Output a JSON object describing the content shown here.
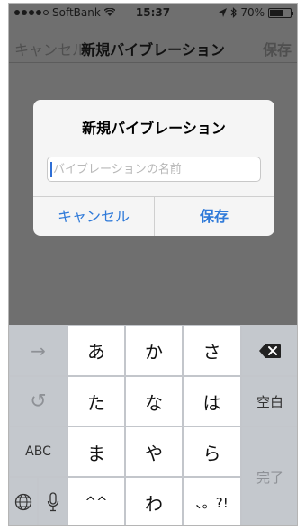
{
  "status": {
    "carrier": "SoftBank",
    "time": "15:37",
    "battery": "70%",
    "battery_level": 0.7
  },
  "navbar": {
    "cancel_label": "キャンセル",
    "title": "新規バイブレーション",
    "save_label": "保存"
  },
  "alert": {
    "title": "新規バイブレーション",
    "input_placeholder": "バイブレーションの名前",
    "input_value": "",
    "cancel_label": "キャンセル",
    "save_label": "保存"
  },
  "keyboard": {
    "left_column": [
      "→",
      "↺",
      "ABC"
    ],
    "rows": [
      [
        "あ",
        "か",
        "さ"
      ],
      [
        "た",
        "な",
        "は"
      ],
      [
        "ま",
        "や",
        "ら"
      ],
      [
        "^^",
        "わ",
        "、。?!"
      ]
    ],
    "right_column": [
      "⌫",
      "空白",
      "完了"
    ],
    "globe_icon": "globe-icon",
    "mic_icon": "mic-icon"
  }
}
